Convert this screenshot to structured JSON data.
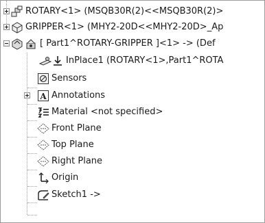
{
  "tree": {
    "items": [
      {
        "label": "ROTARY<1> (MSQB30R(2)<<MSQB30R(2)>"
      },
      {
        "label": "GRIPPER<1> (MHY2-20D<<MHY2-20D>_Ap"
      },
      {
        "label": "[ Part1^ROTARY-GRIPPER ]<1> -> (Def"
      },
      {
        "label": "InPlace1 (ROTARY<1>,Part1^ROTA"
      },
      {
        "label": "Sensors"
      },
      {
        "label": "Annotations"
      },
      {
        "label": "Material <not specified>"
      },
      {
        "label": "Front Plane"
      },
      {
        "label": "Top Plane"
      },
      {
        "label": "Right Plane"
      },
      {
        "label": "Origin"
      },
      {
        "label": "Sketch1 ->"
      }
    ]
  }
}
